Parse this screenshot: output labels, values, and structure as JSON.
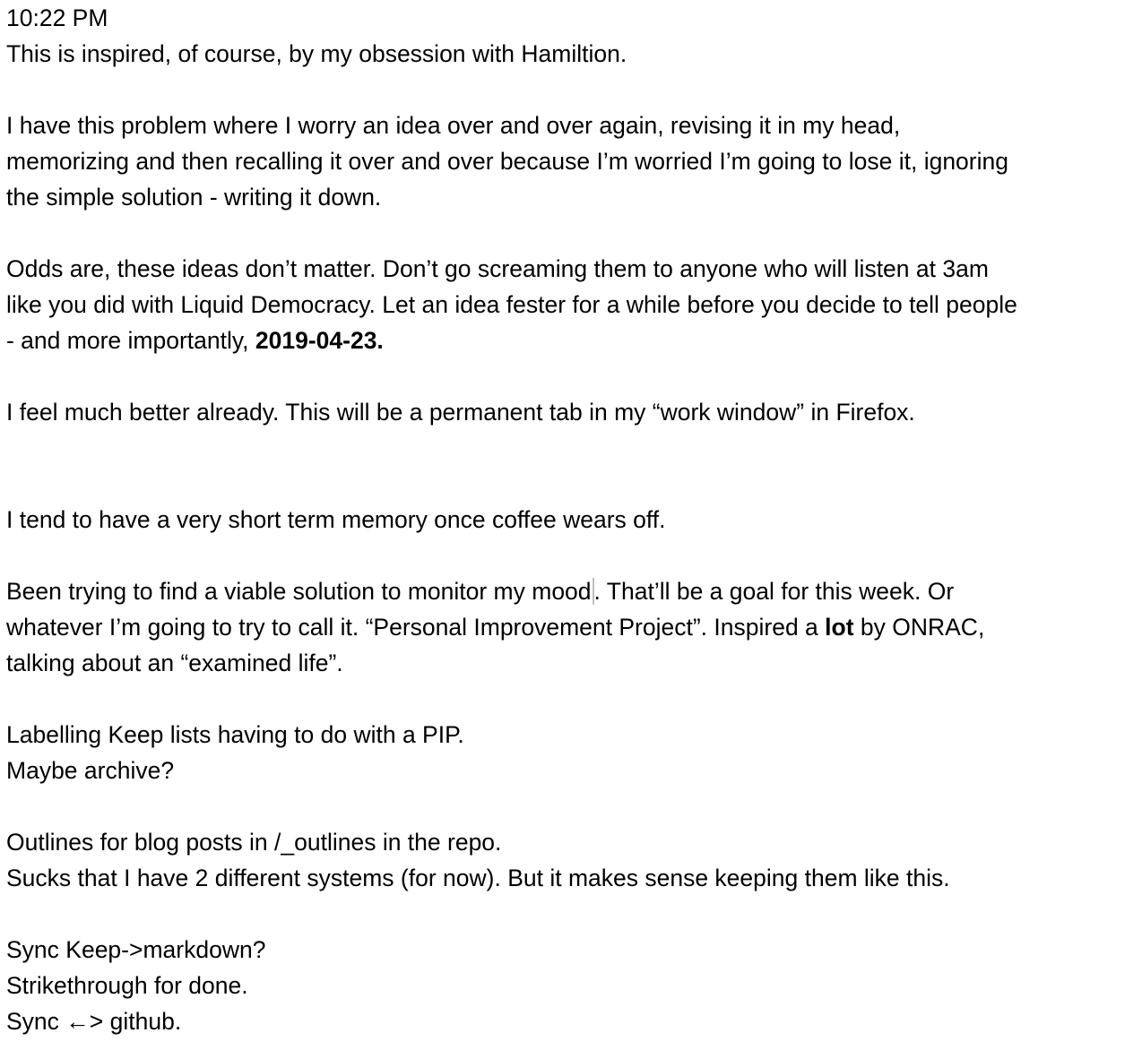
{
  "time": "10:22 PM",
  "p1": "This is inspired, of course, by my obsession with Hamiltion.",
  "p2": [
    "I have this problem where I worry an idea over and over again, revising it in my head,",
    "memorizing and then recalling it over and over because I’m worried I’m going to lose it, ignoring",
    "the simple solution - writing it down."
  ],
  "p3": {
    "l1": "Odds are, these ideas don’t matter. Don’t go screaming them to anyone who will listen at 3am",
    "l2": "like you did with Liquid Democracy. Let an idea fester for a while before you decide to tell people",
    "l3_prefix": "- and more importantly, ",
    "l3_bold": "2019-04-23."
  },
  "p4": "I feel much better already. This will be a permanent tab in my “work window” in Firefox.",
  "p5": "I tend to have a very short term memory once coffee wears off.",
  "p6": {
    "l1_before_cursor": "Been trying to find a viable solution to monitor my mood",
    "l1_after_cursor": ". That’ll be a goal for this week. Or",
    "l2_prefix": "whatever I’m going to try to call it. “Personal Improvement Project”. Inspired a ",
    "l2_bold": "lot",
    "l2_suffix": " by ONRAC,",
    "l3": "talking about an “examined life”."
  },
  "p7": [
    "Labelling Keep lists having to do with a PIP.",
    "Maybe archive?"
  ],
  "p8": [
    "Outlines for blog posts in /_outlines in the repo.",
    "Sucks that I have 2 different systems (for now). But it makes sense keeping them like this."
  ],
  "p9": [
    "Sync Keep->markdown?",
    "Strikethrough for done.",
    "Sync ←> github."
  ]
}
